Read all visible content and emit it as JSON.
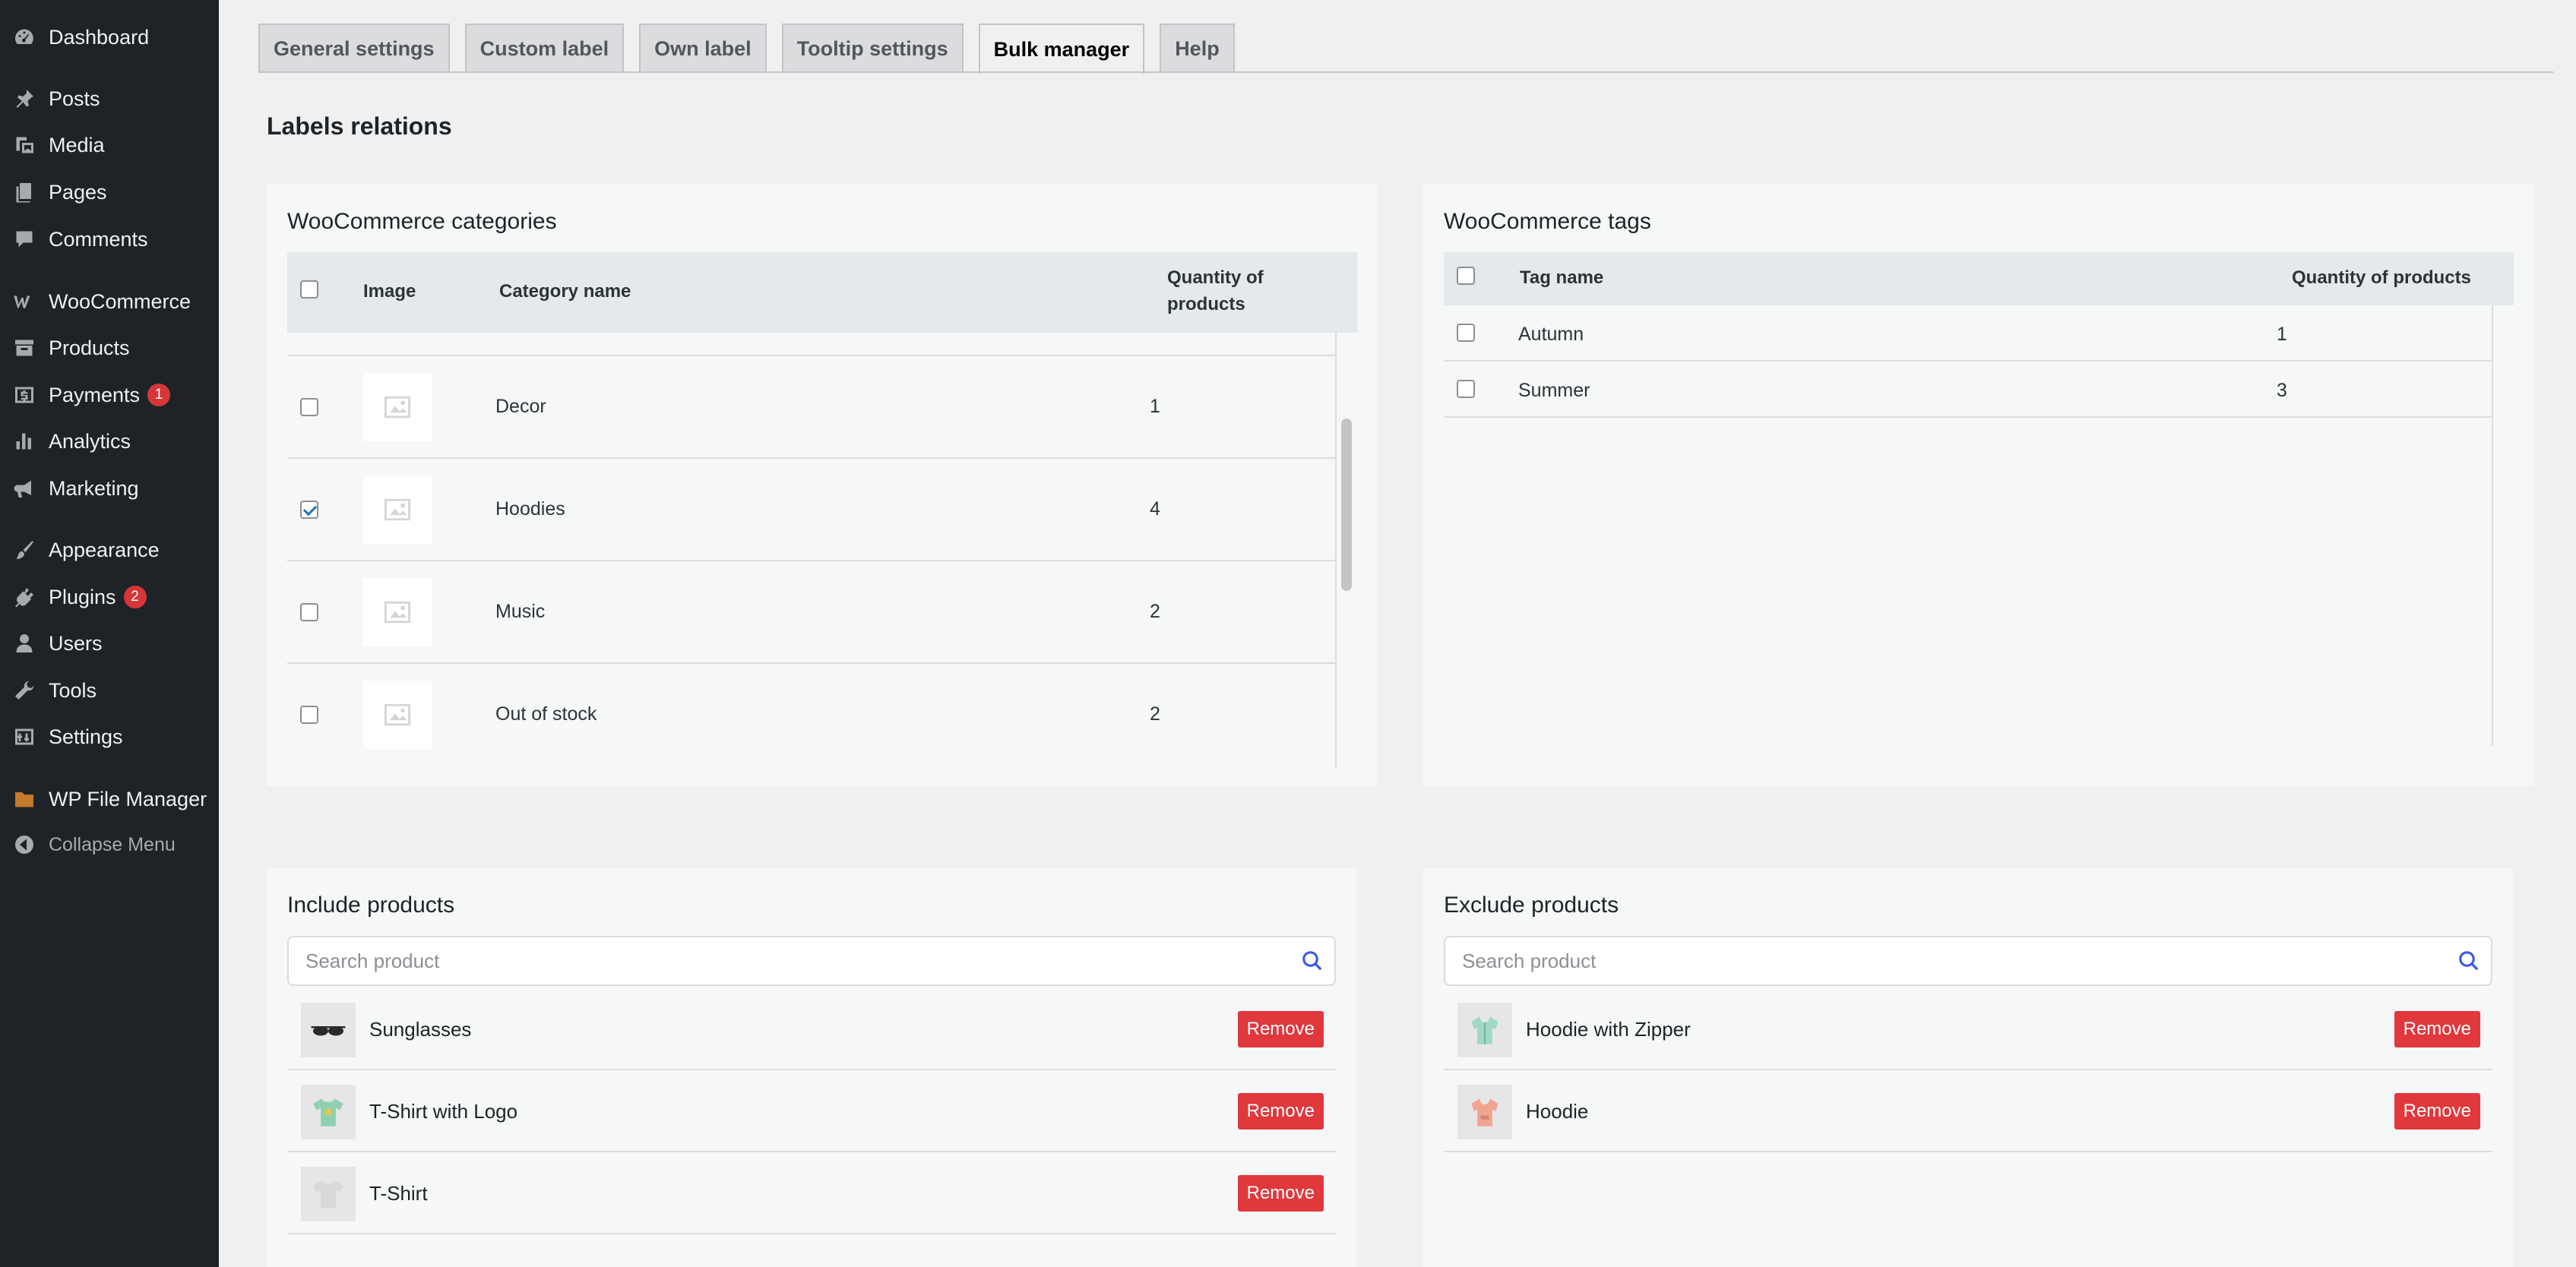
{
  "sidebar": {
    "items": [
      {
        "label": "Dashboard",
        "icon": "dashboard-icon"
      },
      {
        "label": "Posts",
        "icon": "pin-icon"
      },
      {
        "label": "Media",
        "icon": "media-icon"
      },
      {
        "label": "Pages",
        "icon": "pages-icon"
      },
      {
        "label": "Comments",
        "icon": "comment-icon"
      },
      {
        "label": "WooCommerce",
        "icon": "woocommerce-icon"
      },
      {
        "label": "Products",
        "icon": "archive-icon"
      },
      {
        "label": "Payments",
        "icon": "dollar-icon",
        "badge": "1"
      },
      {
        "label": "Analytics",
        "icon": "bar-chart-icon"
      },
      {
        "label": "Marketing",
        "icon": "megaphone-icon"
      },
      {
        "label": "Appearance",
        "icon": "brush-icon"
      },
      {
        "label": "Plugins",
        "icon": "plugin-icon",
        "badge": "2"
      },
      {
        "label": "Users",
        "icon": "user-icon"
      },
      {
        "label": "Tools",
        "icon": "wrench-icon"
      },
      {
        "label": "Settings",
        "icon": "settings-icon"
      },
      {
        "label": "WP File Manager",
        "icon": "folder-icon"
      }
    ],
    "collapse_label": "Collapse Menu"
  },
  "tabs": [
    {
      "label": "General settings",
      "active": false
    },
    {
      "label": "Custom label",
      "active": false
    },
    {
      "label": "Own label",
      "active": false
    },
    {
      "label": "Tooltip settings",
      "active": false
    },
    {
      "label": "Bulk manager",
      "active": true
    },
    {
      "label": "Help",
      "active": false
    }
  ],
  "page_heading": "Labels relations",
  "categories": {
    "title": "WooCommerce categories",
    "headers": {
      "image": "Image",
      "name": "Category name",
      "qty_line1": "Quantity of",
      "qty_line2": "products"
    },
    "rows": [
      {
        "name": "Decor",
        "qty": "1",
        "checked": false
      },
      {
        "name": "Hoodies",
        "qty": "4",
        "checked": true
      },
      {
        "name": "Music",
        "qty": "2",
        "checked": false
      },
      {
        "name": "Out of stock",
        "qty": "2",
        "checked": false
      }
    ]
  },
  "tags": {
    "title": "WooCommerce tags",
    "headers": {
      "name": "Tag name",
      "qty": "Quantity of products"
    },
    "rows": [
      {
        "name": "Autumn",
        "qty": "1",
        "checked": false
      },
      {
        "name": "Summer",
        "qty": "3",
        "checked": false
      }
    ]
  },
  "include": {
    "title": "Include products",
    "search_placeholder": "Search product",
    "remove_label": "Remove",
    "products": [
      {
        "name": "Sunglasses",
        "icon": "sunglasses-icon"
      },
      {
        "name": "T-Shirt with Logo",
        "icon": "tshirt-logo-icon"
      },
      {
        "name": "T-Shirt",
        "icon": "tshirt-icon"
      }
    ]
  },
  "exclude": {
    "title": "Exclude products",
    "search_placeholder": "Search product",
    "remove_label": "Remove",
    "products": [
      {
        "name": "Hoodie with Zipper",
        "icon": "hoodie-zipper-icon"
      },
      {
        "name": "Hoodie",
        "icon": "hoodie-icon"
      }
    ]
  },
  "colors": {
    "sidebar_bg": "#1d2327",
    "remove_red": "#e0383d",
    "badge_red": "#d63638",
    "checkbox_blue": "#2271b1"
  }
}
